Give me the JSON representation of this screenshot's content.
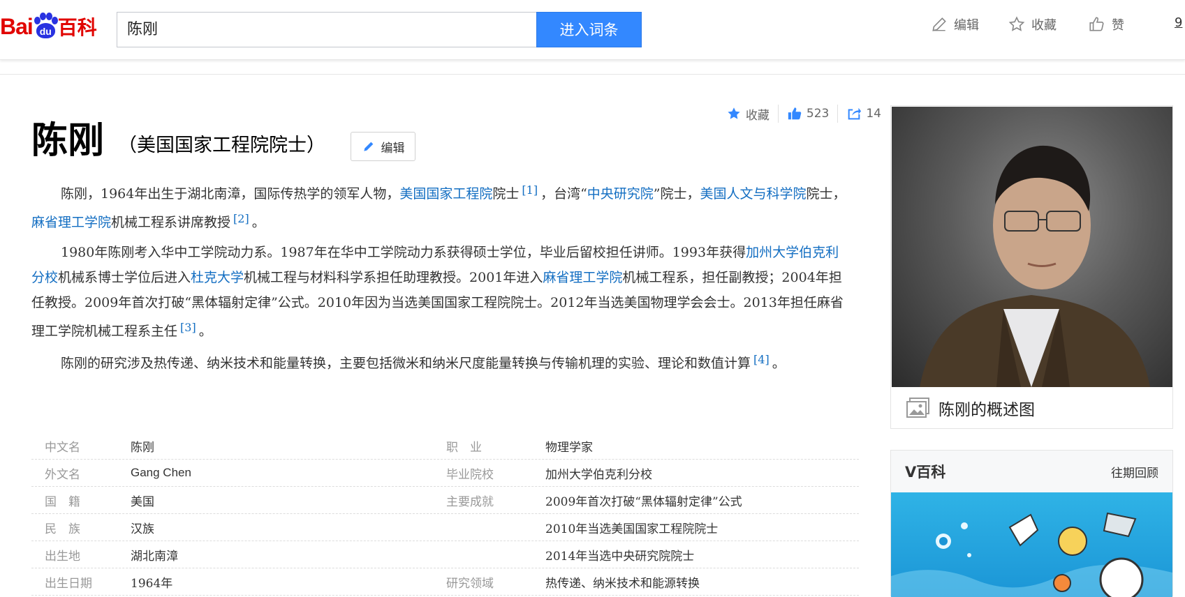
{
  "header": {
    "logo": {
      "part1": "Bai",
      "paw_text": "du",
      "part2": "百科"
    },
    "search_value": "陈刚",
    "search_button": "进入词条",
    "tools": {
      "edit": "编辑",
      "favorite": "收藏",
      "like": "赞",
      "overflow": "9"
    }
  },
  "article": {
    "title": "陈刚",
    "subtitle": "（美国国家工程院院士）",
    "edit_label": "编辑",
    "stats": {
      "favorite": "收藏",
      "likes": "523",
      "shares": "14"
    },
    "p1": {
      "t1": "陈刚，1964年出生于湖北南漳，国际传热学的领军人物，",
      "l1": "美国国家工程院",
      "t2": "院士",
      "r1": "[1]",
      "t3": "，台湾“",
      "l2": "中央研究院",
      "t4": "”院士，",
      "l3": "美国人文与科学院",
      "t5": "院士，",
      "l4": "麻省理工学院",
      "t6": "机械工程系讲席教授",
      "r2": "[2]",
      "t7": "。"
    },
    "p2": {
      "t1": "1980年陈刚考入华中工学院动力系。1987年在华中工学院动力系获得硕士学位，毕业后留校担任讲师。1993年获得",
      "l1": "加州大学伯克利分校",
      "t2": "机械系博士学位后进入",
      "l2": "杜克大学",
      "t3": "机械工程与材料科学系担任助理教授。2001年进入",
      "l3": "麻省理工学院",
      "t4": "机械工程系，担任副教授；2004年担任教授。2009年首次打破“黑体辐射定律”公式。2010年因为当选美国国家工程院院士。2012年当选美国物理学会会士。2013年担任麻省理工学院机械工程系主任",
      "r1": "[3]",
      "t5": "。"
    },
    "p3": {
      "t1": "陈刚的研究涉及热传递、纳米技术和能量转换，主要包括微米和纳米尺度能量转换与传输机理的实验、理论和数值计算",
      "r1": "[4]",
      "t2": "。"
    },
    "infobox": [
      {
        "k": "中文名",
        "v": "陈刚",
        "k2": "职　业",
        "v2": "物理学家"
      },
      {
        "k": "外文名",
        "v": "Gang Chen",
        "k2": "毕业院校",
        "v2": "加州大学伯克利分校"
      },
      {
        "k": "国　籍",
        "v": "美国",
        "k2": "主要成就",
        "v2": "2009年首次打破“黑体辐射定律”公式"
      },
      {
        "k": "民　族",
        "v": "汉族",
        "k2": "",
        "v2": "2010年当选美国国家工程院院士"
      },
      {
        "k": "出生地",
        "v": "湖北南漳",
        "k2": "",
        "v2": "2014年当选中央研究院院士"
      },
      {
        "k": "出生日期",
        "v": "1964年",
        "k2": "研究领域",
        "v2": "热传递、纳米技术和能源转换"
      }
    ]
  },
  "sidebar": {
    "photo_caption": "陈刚的概述图",
    "vbaike_title": "V百科",
    "vbaike_more": "往期回顾"
  },
  "colors": {
    "brand_red": "#e10602",
    "brand_blue": "#2932e1",
    "button_blue": "#3388ff",
    "link": "#136ec2"
  }
}
